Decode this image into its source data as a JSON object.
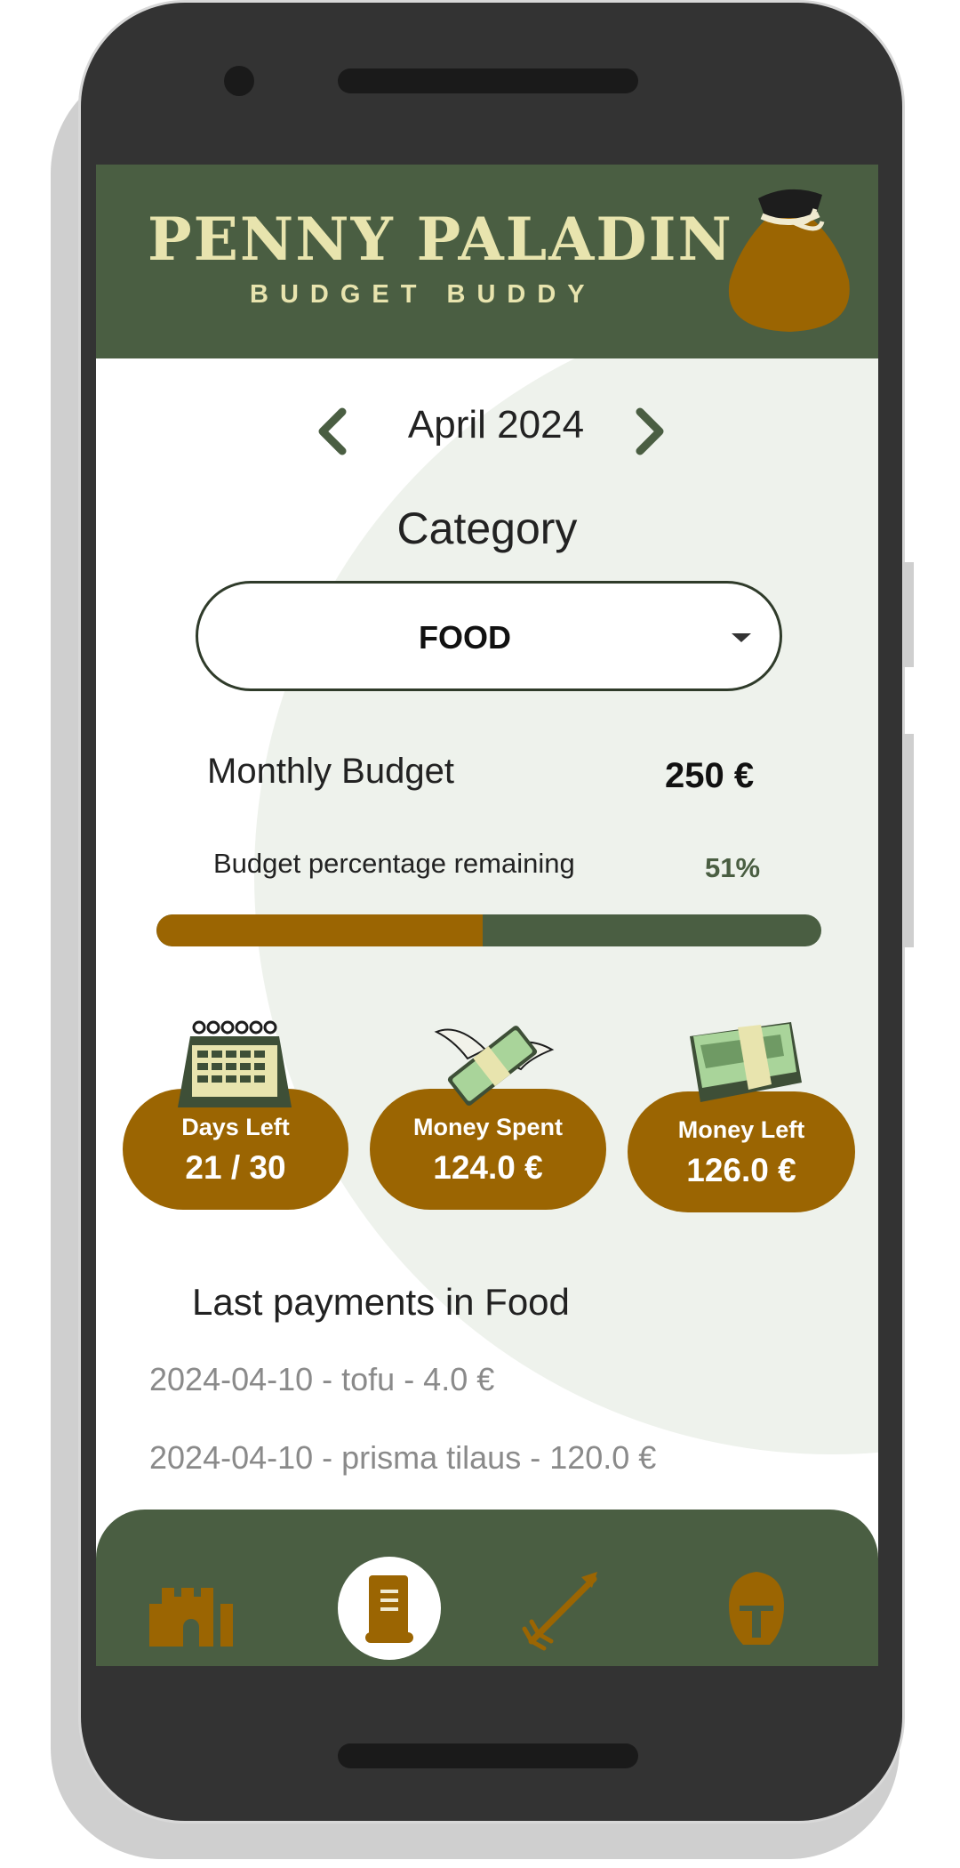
{
  "app": {
    "title": "PENNY PALADIN",
    "subtitle": "BUDGET BUDDY"
  },
  "month_nav": {
    "label": "April 2024"
  },
  "category": {
    "title": "Category",
    "selected": "FOOD"
  },
  "budget": {
    "label": "Monthly Budget",
    "value": "250 €",
    "percentage_label": "Budget percentage remaining",
    "percentage_value": "51%",
    "remaining_fraction": 0.51
  },
  "stats": [
    {
      "label": "Days Left",
      "value": "21 / 30",
      "icon": "calendar-icon"
    },
    {
      "label": "Money Spent",
      "value": "124.0 €",
      "icon": "flying-money-icon"
    },
    {
      "label": "Money Left",
      "value": "126.0 €",
      "icon": "money-stack-icon"
    }
  ],
  "payments": {
    "title": "Last payments in Food",
    "items": [
      "2024-04-10 - tofu - 4.0 €",
      "2024-04-10 - prisma tilaus - 120.0 €"
    ]
  },
  "bottom_nav": {
    "items": [
      "castle-icon",
      "scroll-icon",
      "arrow-icon",
      "helmet-icon"
    ],
    "active": "scroll-icon"
  },
  "colors": {
    "brand_green": "#4a5e42",
    "brand_gold": "#9b6502",
    "header_text": "#e8e4ae"
  }
}
